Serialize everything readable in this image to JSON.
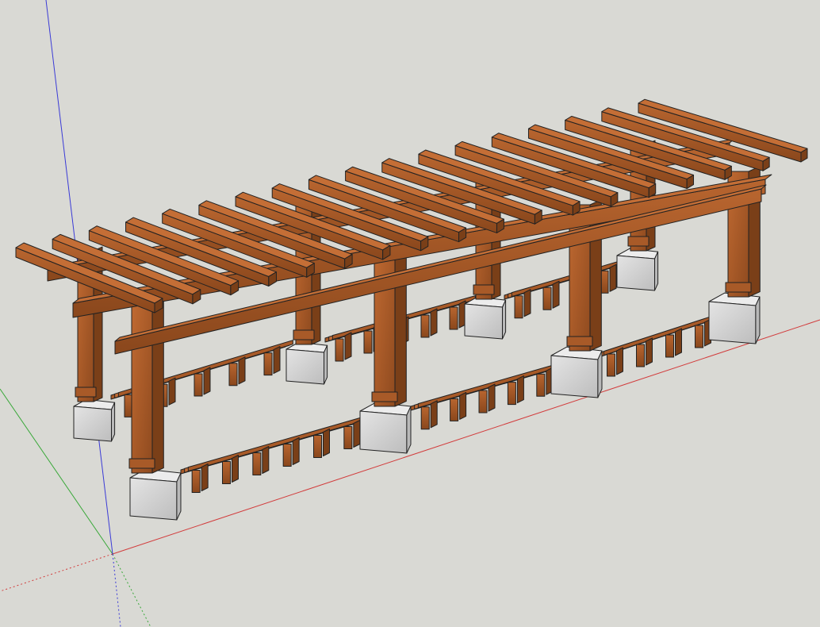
{
  "viewport": {
    "kind": "3d-modeling-viewport",
    "projection": "perspective",
    "background_color": "#d9d9d4"
  },
  "axes": {
    "red_axis_color": "#d23c3c",
    "green_axis_color": "#39a839",
    "blue_axis_color": "#3a3ad6"
  },
  "model": {
    "subject": "pergola",
    "wood_color": "#a85a28",
    "wood_dark_color": "#7a3f18",
    "wood_light_color": "#c46e36",
    "footing_color": "#d6d6d6",
    "edge_color": "#222222"
  }
}
